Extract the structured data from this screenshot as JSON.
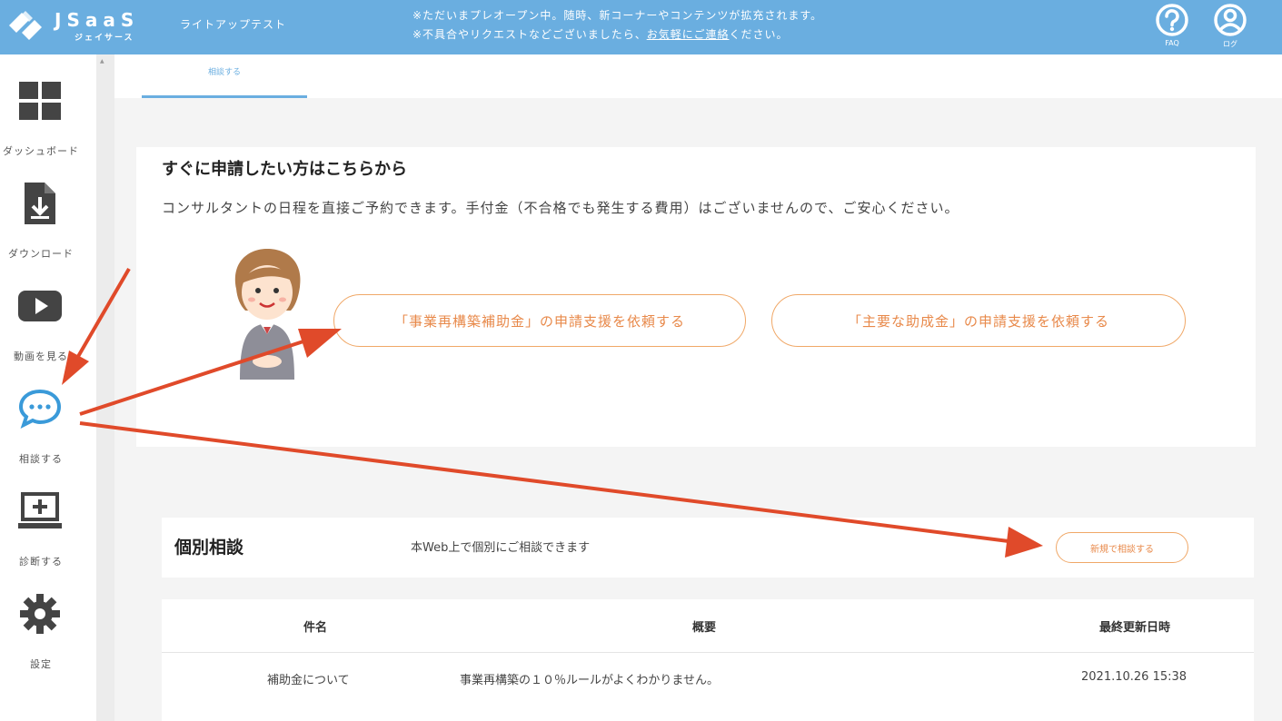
{
  "header": {
    "logo_text": "JSaaS",
    "logo_sub": "ジェイサース",
    "tenant_name": "ライトアップテスト",
    "notice_line1": "※ただいまプレオープン中。随時、新コーナーやコンテンツが拡充されます。",
    "notice_line2_pre": "※不具合やリクエストなどございましたら、",
    "notice_link": "お気軽にご連絡",
    "notice_line2_post": "ください。",
    "faq_label": "FAQ",
    "account_label": "ログ"
  },
  "sidebar": {
    "items": [
      {
        "label": "ダッシュボード",
        "icon": "dashboard-icon"
      },
      {
        "label": "ダウンロード",
        "icon": "download-icon"
      },
      {
        "label": "動画を見る",
        "icon": "video-icon"
      },
      {
        "label": "相談する",
        "icon": "chat-icon"
      },
      {
        "label": "診断する",
        "icon": "diagnose-icon"
      },
      {
        "label": "設定",
        "icon": "gear-icon"
      }
    ]
  },
  "tabs": [
    {
      "label": "相談する"
    }
  ],
  "apply": {
    "title": "すぐに申請したい方はこちらから",
    "description": "コンサルタントの日程を直接ご予約できます。手付金（不合格でも発生する費用）はございませんので、ご安心ください。",
    "button1": "「事業再構築補助金」の申請支援を依頼する",
    "button2": "「主要な助成金」の申請支援を依頼する"
  },
  "consult": {
    "title": "個別相談",
    "description": "本Web上で個別にご相談できます",
    "new_button": "新規で相談する"
  },
  "table": {
    "headers": [
      "件名",
      "概要",
      "最終更新日時"
    ],
    "rows": [
      [
        "補助金について",
        "事業再構築の１０％ルールがよくわかりません。",
        "2021.10.26 15:38"
      ]
    ]
  },
  "colors": {
    "header_bg": "#6aaee0",
    "accent": "#e8894a",
    "arrow": "#e04a2a"
  }
}
